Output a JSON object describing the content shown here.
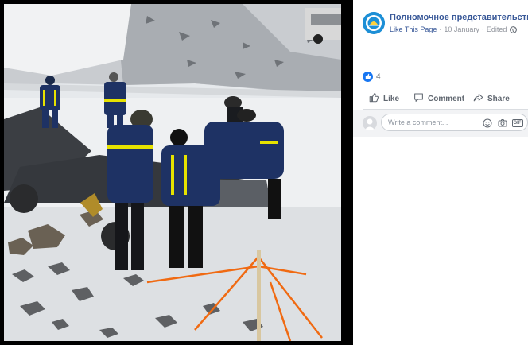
{
  "post": {
    "page_name": "Полномочное представительство",
    "like_page_label": "Like This Page",
    "date": "10 January",
    "edited_label": "Edited",
    "separator": "·"
  },
  "reactions": {
    "count": "4"
  },
  "actions": {
    "like": "Like",
    "comment": "Comment",
    "share": "Share"
  },
  "comment_box": {
    "placeholder": "Write a comment..."
  },
  "colors": {
    "link": "#385898",
    "like_blue": "#1877f2",
    "muted": "#90949c",
    "tarp": "#3c3f44",
    "tape": "#f06a12"
  },
  "icons": [
    "page-avatar-icon",
    "globe-icon",
    "like-reaction-icon",
    "thumb-up-icon",
    "comment-icon",
    "share-icon",
    "user-avatar-icon",
    "emoji-icon",
    "camera-icon",
    "gif-icon"
  ]
}
